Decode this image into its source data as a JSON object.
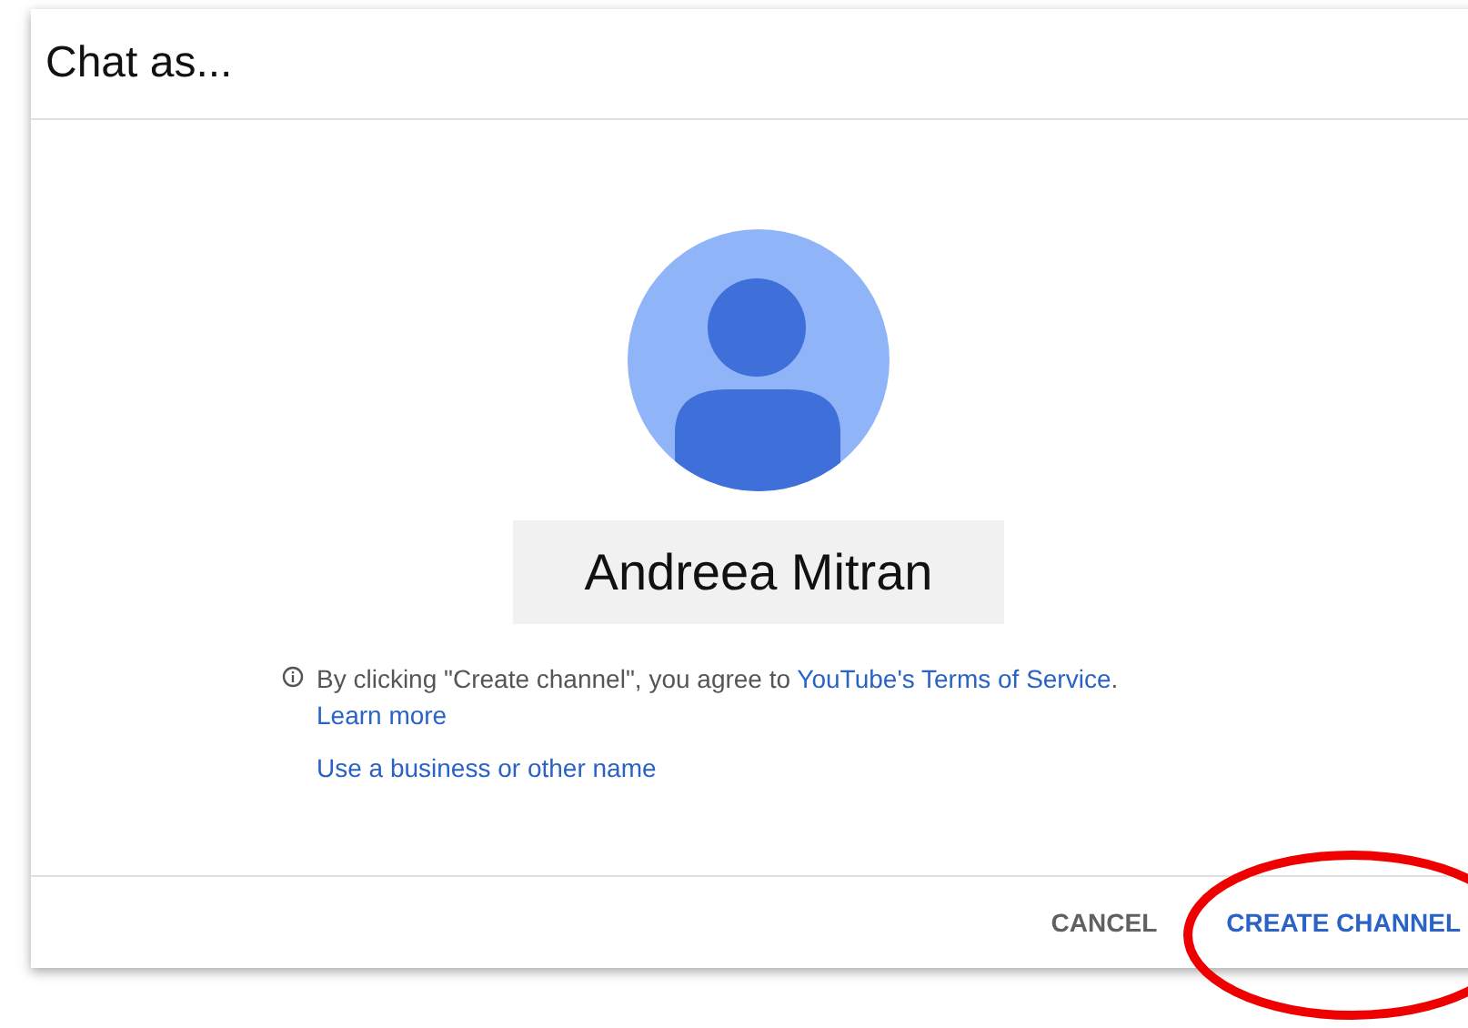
{
  "dialog": {
    "title": "Chat as...",
    "name": "Andreea Mitran",
    "notice": {
      "text": "By clicking \"Create channel\", you agree to ",
      "link": "YouTube's Terms of Service",
      "end": "."
    },
    "learn_more": "Learn more",
    "alt_name_link": "Use a business or other name",
    "buttons": [
      {
        "label": "CANCEL",
        "kind": "secondary"
      },
      {
        "label": "CREATE CHANNEL",
        "kind": "primary"
      }
    ]
  }
}
